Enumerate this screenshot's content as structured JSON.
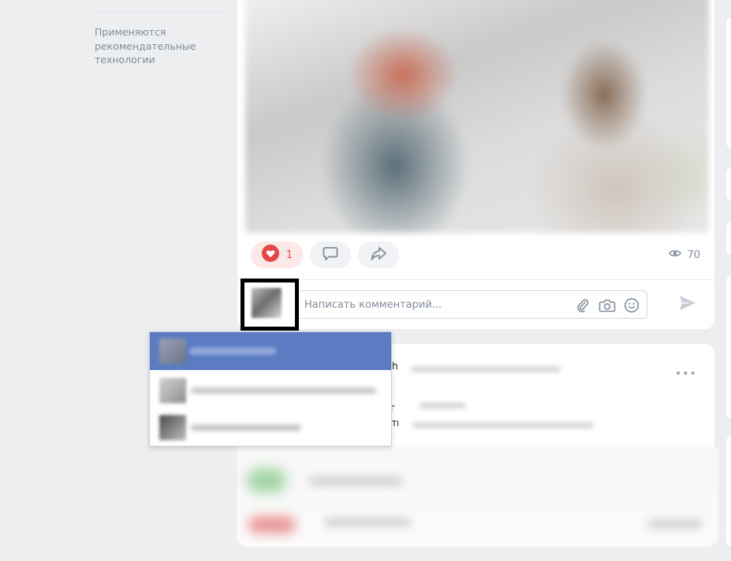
{
  "sidebar": {
    "recommendation_note": "Применяются рекомендательные технологии"
  },
  "post": {
    "like_count": "1",
    "view_count": "70",
    "comment_placeholder": "Написать комментарий..."
  },
  "icons": {
    "like": "heart-icon",
    "comment": "comment-bubble-icon",
    "share": "share-arrow-icon",
    "views": "eye-icon",
    "attach": "paperclip-icon",
    "photo": "camera-icon",
    "emoji": "smile-icon",
    "send": "send-icon",
    "more": "more-dots-icon"
  },
  "post2": {
    "more_label": "•••",
    "text_fragments": [
      "h",
      "г",
      "TI"
    ]
  },
  "colors": {
    "accent_blue": "#5b7cc2",
    "like_red": "#e64646",
    "muted": "#818c99",
    "background": "#edeef0"
  },
  "account_menu": {
    "selected_index": 0,
    "item_count": 3
  }
}
